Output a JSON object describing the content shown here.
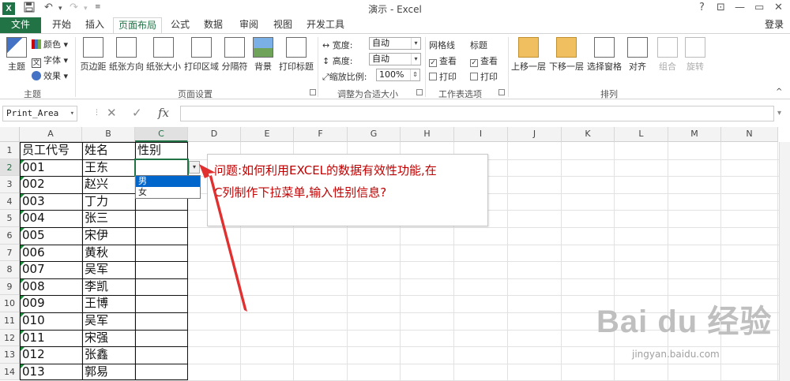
{
  "window": {
    "title": "演示 - Excel",
    "help": "?",
    "restore": "⊡",
    "minimize": "—",
    "maximize": "▭",
    "close": "✕"
  },
  "qat": {
    "app_icon": "X",
    "save_icon": "floppy-icon",
    "undo": "↶",
    "redo": "↷"
  },
  "tabs": [
    "文件",
    "开始",
    "插入",
    "页面布局",
    "公式",
    "数据",
    "审阅",
    "视图",
    "开发工具"
  ],
  "active_tab": "页面布局",
  "login": "登录",
  "ribbon": {
    "theme_group": {
      "name": "主题",
      "big": "主题",
      "colors": "颜色",
      "fonts": "字体",
      "effects": "效果"
    },
    "page_setup": {
      "name": "页面设置",
      "buttons": [
        "页边距",
        "纸张方向",
        "纸张大小",
        "打印区域",
        "分隔符",
        "背景",
        "打印标题"
      ]
    },
    "scale": {
      "name": "调整为合适大小",
      "width_label": "宽度:",
      "width_value": "自动",
      "height_label": "高度:",
      "height_value": "自动",
      "scale_label": "缩放比例:",
      "scale_value": "100%"
    },
    "sheet_options": {
      "name": "工作表选项",
      "gridlines": "网格线",
      "headings": "标题",
      "view": "查看",
      "print": "打印"
    },
    "arrange": {
      "name": "排列",
      "buttons": [
        "上移一层",
        "下移一层",
        "选择窗格",
        "对齐",
        "组合",
        "旋转"
      ]
    }
  },
  "formula_bar": {
    "name_box": "Print_Area",
    "cancel": "✕",
    "enter": "✓",
    "fx": "fx",
    "value": ""
  },
  "columns": [
    "A",
    "B",
    "C",
    "D",
    "E",
    "F",
    "G",
    "H",
    "I",
    "J",
    "K",
    "L",
    "M",
    "N"
  ],
  "rows": [
    "1",
    "2",
    "3",
    "4",
    "5",
    "6",
    "7",
    "8",
    "9",
    "10",
    "11",
    "12",
    "13",
    "14"
  ],
  "table": {
    "headers": [
      "员工代号",
      "姓名",
      "性别"
    ],
    "ids": [
      "001",
      "002",
      "003",
      "004",
      "005",
      "006",
      "007",
      "008",
      "009",
      "010",
      "011",
      "012",
      "013"
    ],
    "names": [
      "王东",
      "赵兴",
      "丁力",
      "张三",
      "宋伊",
      "黄秋",
      "吴军",
      "李凯",
      "王博",
      "吴军",
      "宋强",
      "张鑫",
      "郭易"
    ]
  },
  "dropdown": {
    "options": [
      "男",
      "女"
    ],
    "highlighted": 0
  },
  "callout": {
    "line1": "问题:如何利用EXCEL的数据有效性功能,在",
    "line2": "C列制作下拉菜单,输入性别信息?"
  },
  "watermark": {
    "logo": "Bai du 经验",
    "url": "jingyan.baidu.com"
  },
  "colors": {
    "excel_green": "#217346",
    "callout_text": "#c00000",
    "arrow": "#e03030"
  }
}
